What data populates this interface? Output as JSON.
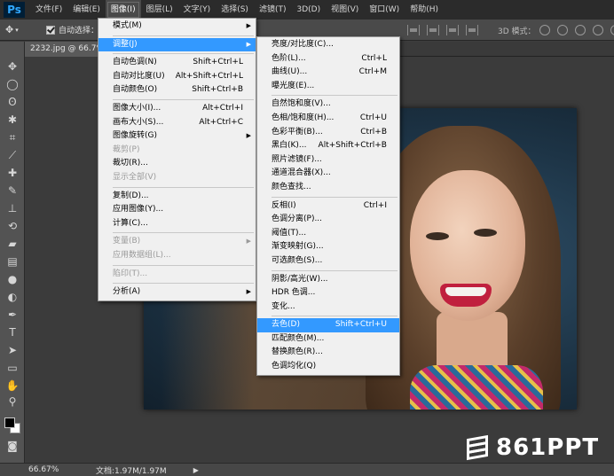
{
  "app": {
    "logo": "Ps"
  },
  "menubar": [
    {
      "label": "文件(F)"
    },
    {
      "label": "编辑(E)"
    },
    {
      "label": "图像(I)",
      "active": true
    },
    {
      "label": "图层(L)"
    },
    {
      "label": "文字(Y)"
    },
    {
      "label": "选择(S)"
    },
    {
      "label": "滤镜(T)"
    },
    {
      "label": "3D(D)"
    },
    {
      "label": "视图(V)"
    },
    {
      "label": "窗口(W)"
    },
    {
      "label": "帮助(H)"
    }
  ],
  "options": {
    "auto_select": "自动选择：",
    "mode_3d": "3D 模式："
  },
  "document": {
    "tab": "2232.jpg @ 66.7%"
  },
  "image_menu": [
    {
      "label": "模式(M)",
      "submenu": true
    },
    {
      "sep": true
    },
    {
      "label": "调整(J)",
      "submenu": true,
      "highlight": true
    },
    {
      "sep": true
    },
    {
      "label": "自动色调(N)",
      "shortcut": "Shift+Ctrl+L"
    },
    {
      "label": "自动对比度(U)",
      "shortcut": "Alt+Shift+Ctrl+L"
    },
    {
      "label": "自动颜色(O)",
      "shortcut": "Shift+Ctrl+B"
    },
    {
      "sep": true
    },
    {
      "label": "图像大小(I)...",
      "shortcut": "Alt+Ctrl+I"
    },
    {
      "label": "画布大小(S)...",
      "shortcut": "Alt+Ctrl+C"
    },
    {
      "label": "图像旋转(G)",
      "submenu": true
    },
    {
      "label": "裁剪(P)",
      "disabled": true
    },
    {
      "label": "裁切(R)..."
    },
    {
      "label": "显示全部(V)",
      "disabled": true
    },
    {
      "sep": true
    },
    {
      "label": "复制(D)..."
    },
    {
      "label": "应用图像(Y)..."
    },
    {
      "label": "计算(C)..."
    },
    {
      "sep": true
    },
    {
      "label": "变量(B)",
      "disabled": true,
      "submenu": true
    },
    {
      "label": "应用数据组(L)...",
      "disabled": true
    },
    {
      "sep": true
    },
    {
      "label": "陷印(T)...",
      "disabled": true
    },
    {
      "sep": true
    },
    {
      "label": "分析(A)",
      "submenu": true
    }
  ],
  "adjust_menu": [
    {
      "label": "亮度/对比度(C)..."
    },
    {
      "label": "色阶(L)...",
      "shortcut": "Ctrl+L"
    },
    {
      "label": "曲线(U)...",
      "shortcut": "Ctrl+M"
    },
    {
      "label": "曝光度(E)..."
    },
    {
      "sep": true
    },
    {
      "label": "自然饱和度(V)..."
    },
    {
      "label": "色相/饱和度(H)...",
      "shortcut": "Ctrl+U"
    },
    {
      "label": "色彩平衡(B)...",
      "shortcut": "Ctrl+B"
    },
    {
      "label": "黑白(K)...",
      "shortcut": "Alt+Shift+Ctrl+B"
    },
    {
      "label": "照片滤镜(F)..."
    },
    {
      "label": "通道混合器(X)..."
    },
    {
      "label": "颜色查找..."
    },
    {
      "sep": true
    },
    {
      "label": "反相(I)",
      "shortcut": "Ctrl+I"
    },
    {
      "label": "色调分离(P)..."
    },
    {
      "label": "阈值(T)..."
    },
    {
      "label": "渐变映射(G)..."
    },
    {
      "label": "可选颜色(S)..."
    },
    {
      "sep": true
    },
    {
      "label": "阴影/高光(W)..."
    },
    {
      "label": "HDR 色调..."
    },
    {
      "label": "变化..."
    },
    {
      "sep": true
    },
    {
      "label": "去色(D)",
      "shortcut": "Shift+Ctrl+U",
      "highlight": true
    },
    {
      "label": "匹配颜色(M)..."
    },
    {
      "label": "替换颜色(R)..."
    },
    {
      "label": "色调均化(Q)"
    }
  ],
  "status": {
    "zoom": "66.67%",
    "doc_info": "文档:1.97M/1.97M"
  },
  "watermark": {
    "text": "861PPT"
  },
  "colors": {
    "menu_highlight": "#3399ff",
    "menubar_bg": "#2b2b2b",
    "workspace_bg": "#3b3b3b"
  }
}
